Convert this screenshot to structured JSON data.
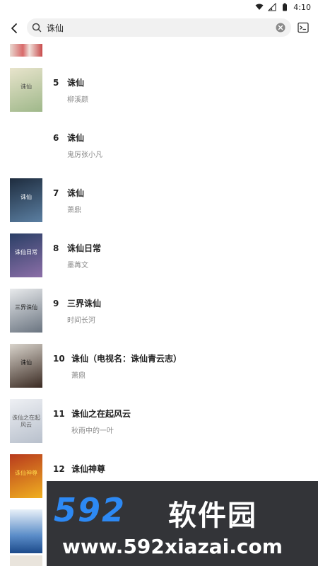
{
  "status_bar": {
    "time": "4:10"
  },
  "search": {
    "query": "诛仙"
  },
  "results": [
    {
      "rank": "5",
      "title": "诛仙",
      "author": "柳溪颜",
      "cover_text": "诛仙",
      "cover_bg": "#e8e4cc",
      "cover_accent": "#9fb88a"
    },
    {
      "rank": "6",
      "title": "诛仙",
      "author": "鬼厉张小凡",
      "cover_text": "",
      "cover_bg": "#ffffff",
      "cover_accent": "#ffffff"
    },
    {
      "rank": "7",
      "title": "诛仙",
      "author": "萧鼎",
      "cover_text": "诛仙",
      "cover_bg": "#1e2c3e",
      "cover_accent": "#5b7fa2"
    },
    {
      "rank": "8",
      "title": "诛仙日常",
      "author": "墨苒文",
      "cover_text": "诛仙日常",
      "cover_bg": "#2a3f66",
      "cover_accent": "#8c6fa8"
    },
    {
      "rank": "9",
      "title": "三界诛仙",
      "author": "时间长河",
      "cover_text": "三界诛仙",
      "cover_bg": "#e8eaec",
      "cover_accent": "#6a7480"
    },
    {
      "rank": "10",
      "title": "诛仙（电视名：诛仙青云志）",
      "author": "萧鼎",
      "cover_text": "诛仙",
      "cover_bg": "#d9d4cc",
      "cover_accent": "#3a2a22"
    },
    {
      "rank": "11",
      "title": "诛仙之在起风云",
      "author": "秋雨中的一叶",
      "cover_text": "诛仙之在起风云",
      "cover_bg": "#eef0f4",
      "cover_accent": "#b8c0cc"
    },
    {
      "rank": "12",
      "title": "诛仙神尊",
      "author": "",
      "cover_text": "诛仙神尊",
      "cover_bg": "#b83a1e",
      "cover_accent": "#f0b020"
    }
  ],
  "watermark": {
    "brand": "592",
    "name": "软件园",
    "url": "www.592xiazai.com"
  }
}
